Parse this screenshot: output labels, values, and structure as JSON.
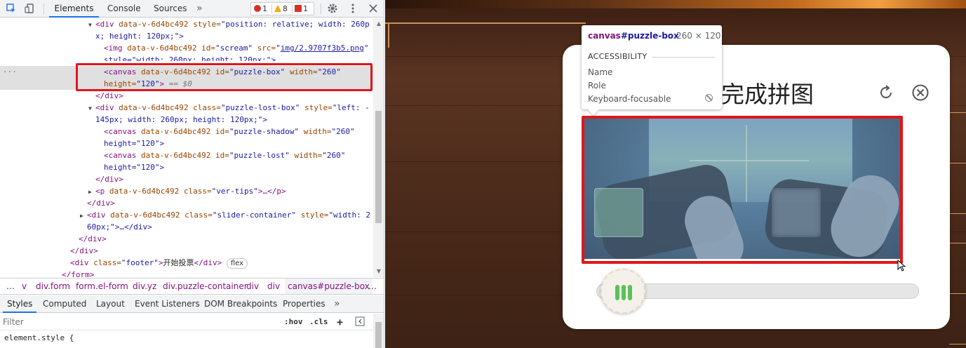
{
  "devtools": {
    "tabs": [
      "Elements",
      "Console",
      "Sources"
    ],
    "more_tabs": "»",
    "badges": {
      "errors": "1",
      "warnings": "8",
      "issues": "1"
    },
    "dom": {
      "l1": {
        "tag_open": "<div",
        "attr": "data-v-6d4bc492",
        "style_attr": "style=",
        "style_val": "\"position: relative; width: 260p"
      },
      "l1b": "x; height: 120px;\">",
      "l2": {
        "tag": "<img",
        "attr": "data-v-6d4bc492",
        "id_attr": "id=",
        "id_val": "\"scream\"",
        "src_attr": "src=",
        "src_val": "img/2.9707f3b5.png"
      },
      "l2b": "style=\"width: 260px; height: 120px;\">",
      "l3": {
        "tag": "<canvas",
        "attr": "data-v-6d4bc492",
        "id_attr": "id=",
        "id_val": "\"puzzle-box\"",
        "w_attr": "width=",
        "w_val": "\"260\""
      },
      "l3b": {
        "h_attr": "height=",
        "h_val": "\"120\"",
        "close": ">",
        "eq": "== $0"
      },
      "l4": "</div>",
      "l5": {
        "tag": "<div",
        "attr": "data-v-6d4bc492",
        "class_attr": "class=",
        "class_val": "\"puzzle-lost-box\"",
        "style_attr": "style=",
        "style_val": "\"left: -"
      },
      "l5b": "145px; width: 260px; height: 120px;\">",
      "l6": {
        "tag": "<canvas",
        "attr": "data-v-6d4bc492",
        "id_attr": "id=",
        "id_val": "\"puzzle-shadow\"",
        "w_attr": "width=",
        "w_val": "\"260\""
      },
      "l6b": "height=\"120\">",
      "l7": {
        "tag": "<canvas",
        "attr": "data-v-6d4bc492",
        "id_attr": "id=",
        "id_val": "\"puzzle-lost\"",
        "w_attr": "width=",
        "w_val": "\"260\""
      },
      "l7b": "height=\"120\">",
      "l8": "</div>",
      "l9": {
        "tag": "<p",
        "attr": "data-v-6d4bc492",
        "class_attr": "class=",
        "class_val": "\"ver-tips\"",
        "rest": ">…</p>"
      },
      "l10": "</div>",
      "l11": {
        "tag": "<div",
        "attr": "data-v-6d4bc492",
        "class_attr": "class=",
        "class_val": "\"slider-container\"",
        "style_attr": "style=",
        "style_val": "\"width: 2"
      },
      "l11b": "60px;\">…</div>",
      "l12": "</div>",
      "l13": "</div>",
      "l14": {
        "tag": "<div",
        "class_attr": "class=",
        "class_val": "\"footer\"",
        "text": "开始投票",
        "close": "</div>",
        "pill": "flex"
      },
      "l15": "</form>"
    },
    "breadcrumbs": [
      "…",
      "v",
      "div.form",
      "form.el-form",
      "div.yz",
      "div.puzzle-container",
      "div",
      "div",
      "canvas#puzzle-box",
      "…"
    ],
    "sub_tabs": [
      "Styles",
      "Computed",
      "Layout",
      "Event Listeners",
      "DOM Breakpoints",
      "Properties"
    ],
    "sub_more": "»",
    "filter": {
      "placeholder": "Filter",
      "hov": ":hov",
      "cls": ".cls",
      "plus": "+"
    },
    "style_rule": "element.style {"
  },
  "tooltip": {
    "tag": "canvas",
    "id": "#puzzle-box",
    "dims": "260 × 120",
    "section": "ACCESSIBILITY",
    "rows": [
      "Name",
      "Role",
      "Keyboard-focusable"
    ]
  },
  "modal": {
    "title": "滑块完成拼图"
  },
  "colors": {
    "highlight": "#e0161b",
    "accent": "#1a73e8",
    "slider_bar": "#5cc15c"
  }
}
